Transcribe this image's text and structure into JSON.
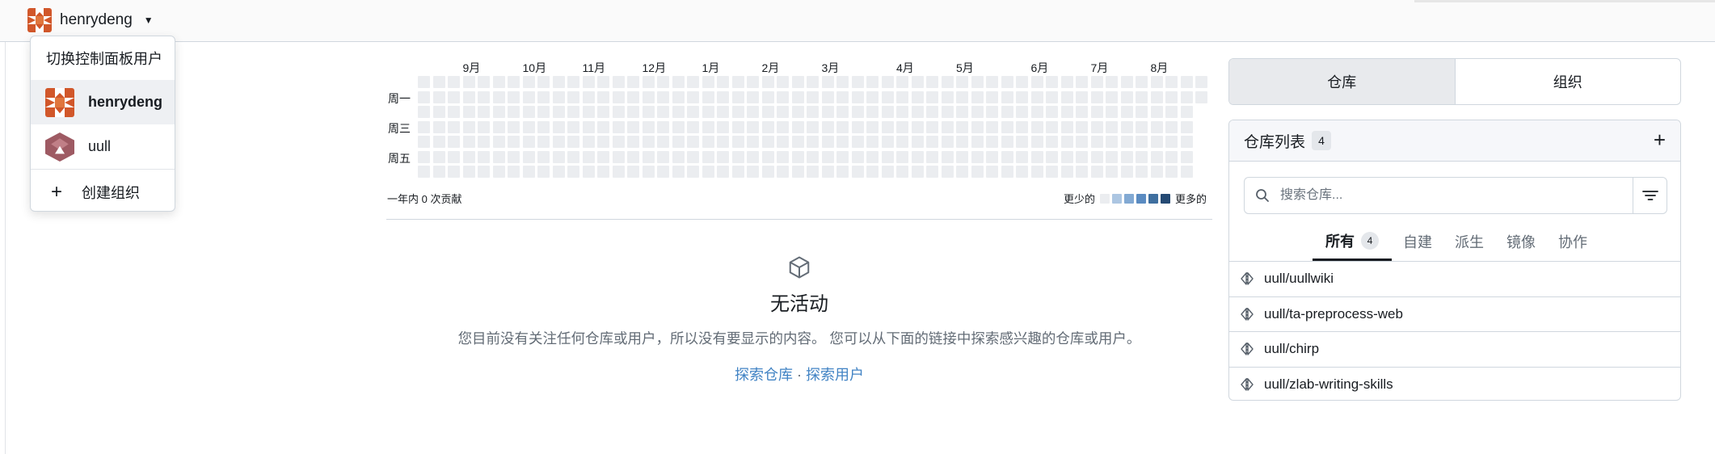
{
  "topbar": {
    "context_user": "henrydeng"
  },
  "dropdown": {
    "header": "切换控制面板用户",
    "items": [
      {
        "label": "henrydeng",
        "active": true
      },
      {
        "label": "uull",
        "active": false
      }
    ],
    "create_label": "创建组织"
  },
  "heatmap": {
    "months": [
      "9月",
      "10月",
      "11月",
      "12月",
      "1月",
      "2月",
      "3月",
      "4月",
      "5月",
      "6月",
      "7月",
      "8月"
    ],
    "day_labels": [
      "周一",
      "周三",
      "周五"
    ],
    "total_text": "一年内 0 次贡献",
    "legend_less": "更少的",
    "legend_more": "更多的",
    "legend_colors": [
      "#ebedf0",
      "#acc6e2",
      "#82a9d3",
      "#5a8bc1",
      "#3f6f9f",
      "#254a73"
    ],
    "cell_color": "#ebedf0"
  },
  "feed": {
    "empty_icon": "cube-icon",
    "empty_title": "无活动",
    "empty_desc": "您目前没有关注任何仓库或用户，所以没有要显示的内容。 您可以从下面的链接中探索感兴趣的仓库或用户。",
    "explore_repos": "探索仓库",
    "separator": "·",
    "explore_users": "探索用户"
  },
  "dashboard_tabs": [
    {
      "label": "仓库",
      "active": true
    },
    {
      "label": "组织",
      "active": false
    }
  ],
  "repo_panel": {
    "title": "仓库列表",
    "count": "4",
    "search_placeholder": "搜索仓库...",
    "filter_tabs": [
      {
        "label": "所有",
        "active": true,
        "count": "4"
      },
      {
        "label": "自建",
        "active": false
      },
      {
        "label": "派生",
        "active": false
      },
      {
        "label": "镜像",
        "active": false
      },
      {
        "label": "协作",
        "active": false
      }
    ],
    "repos": [
      {
        "name": "uull/uullwiki",
        "icon": "mirror-icon"
      },
      {
        "name": "uull/ta-preprocess-web",
        "icon": "mirror-icon"
      },
      {
        "name": "uull/chirp",
        "icon": "mirror-icon"
      },
      {
        "name": "uull/zlab-writing-skills",
        "icon": "mirror-icon"
      }
    ]
  },
  "colors": {
    "link": "#4183c4",
    "border": "#d0d7de",
    "muted_text": "#636c76",
    "henry_avatar": "#d1572a",
    "uull_avatar": "#9e5a63"
  }
}
